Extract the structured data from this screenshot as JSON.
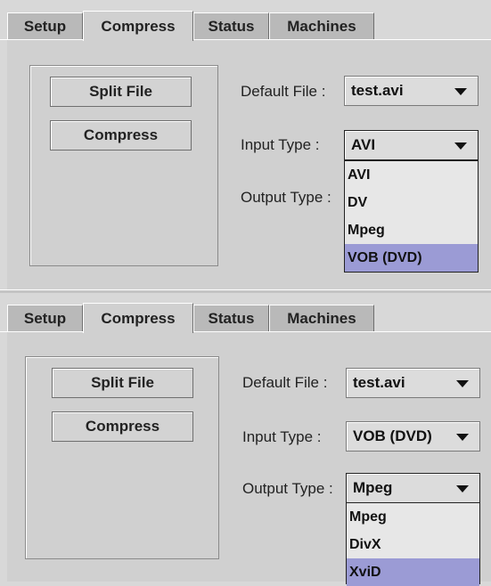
{
  "tabs": [
    {
      "label": "Setup"
    },
    {
      "label": "Compress"
    },
    {
      "label": "Status"
    },
    {
      "label": "Machines"
    }
  ],
  "buttons": {
    "split_file": "Split File",
    "compress": "Compress"
  },
  "labels": {
    "default_file": "Default File :",
    "input_type": "Input Type :",
    "output_type": "Output Type :"
  },
  "top_panel": {
    "default_file_value": "test.avi",
    "input_type_value": "AVI",
    "input_dropdown_options": [
      "AVI",
      "DV",
      "Mpeg",
      "VOB (DVD)"
    ],
    "highlighted_option": "VOB (DVD)"
  },
  "bottom_panel": {
    "default_file_value": "test.avi",
    "input_type_value": "VOB (DVD)",
    "output_type_value": "Mpeg",
    "output_dropdown_options": [
      "Mpeg",
      "DivX",
      "XviD"
    ],
    "highlighted_option": "XviD"
  },
  "colors": {
    "selection": "#9b9bd5",
    "panel": "#d0d0d0",
    "inactive_tab": "#b9b9b9"
  }
}
